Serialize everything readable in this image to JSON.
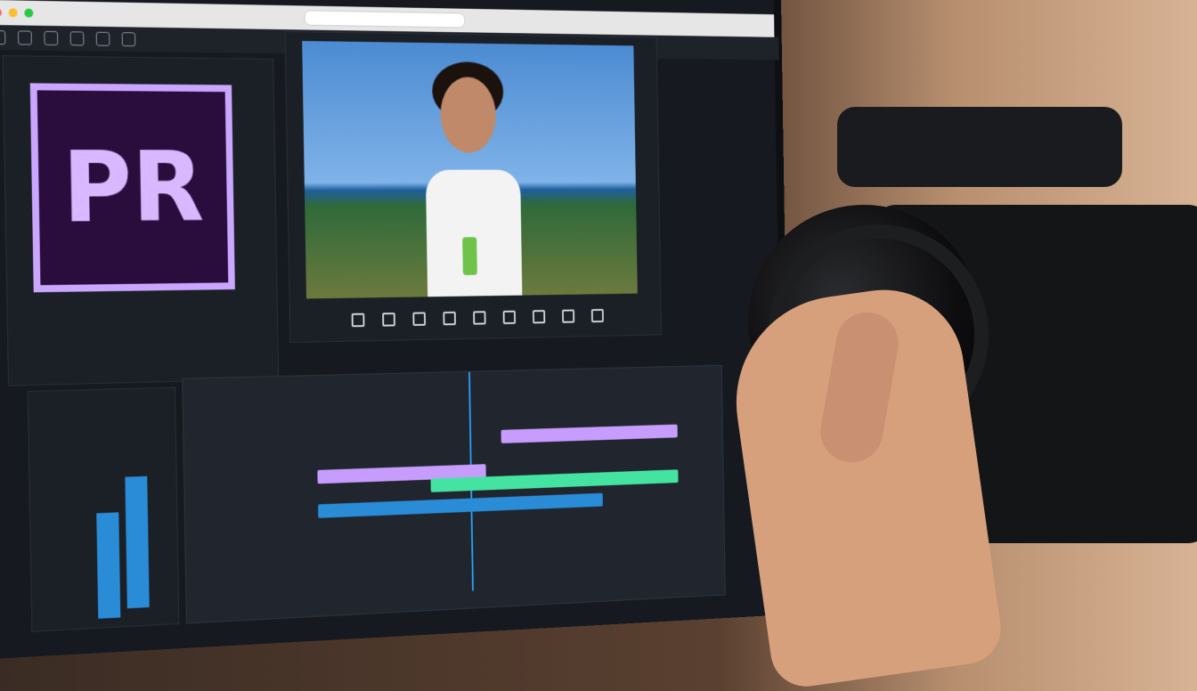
{
  "window": {
    "traffic_lights": [
      "#ff5f57",
      "#febc2e",
      "#28c840"
    ]
  },
  "app": {
    "logo_text": "PR",
    "logo_border_color": "#c9a6ff",
    "logo_bg_color": "#2b0d3d"
  },
  "monitor": {
    "controls": [
      "rectangle-icon",
      "shield-icon",
      "bracket-icon",
      "refresh-icon",
      "loop-icon",
      "prev-icon",
      "play-icon",
      "step-icon",
      "record-icon"
    ]
  },
  "timeline": {
    "playhead_color": "#2aa4ff",
    "tracks": [
      {
        "name": "purple-clip-1",
        "color": "#c79cff"
      },
      {
        "name": "purple-clip-2",
        "color": "#c79cff"
      },
      {
        "name": "blue-clip-1",
        "color": "#2a8bd6"
      },
      {
        "name": "green-clip-1",
        "color": "#44e3a2"
      }
    ]
  }
}
